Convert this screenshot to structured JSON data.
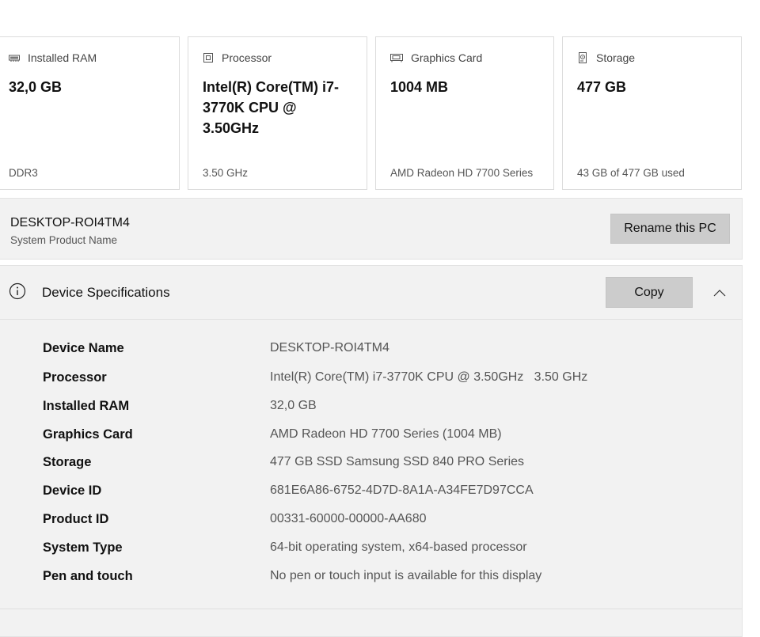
{
  "cards": [
    {
      "icon": "ram-icon",
      "label": "Installed RAM",
      "value": "32,0 GB",
      "sub": "DDR3"
    },
    {
      "icon": "processor-icon",
      "label": "Processor",
      "value": "Intel(R) Core(TM) i7-3770K CPU @ 3.50GHz",
      "sub": "3.50 GHz"
    },
    {
      "icon": "graphics-card-icon",
      "label": "Graphics Card",
      "value": "1004 MB",
      "sub": "AMD Radeon HD 7700 Series"
    },
    {
      "icon": "storage-icon",
      "label": "Storage",
      "value": "477 GB",
      "sub": "43 GB of 477 GB used"
    }
  ],
  "pc": {
    "name": "DESKTOP-ROI4TM4",
    "subtitle": "System Product Name",
    "rename_label": "Rename this PC"
  },
  "specs": {
    "title": "Device Specifications",
    "copy_label": "Copy",
    "rows": [
      {
        "key": "Device Name",
        "value": "DESKTOP-ROI4TM4"
      },
      {
        "key": "Processor",
        "value": "Intel(R) Core(TM) i7-3770K CPU @ 3.50GHz   3.50 GHz"
      },
      {
        "key": "Installed RAM",
        "value": "32,0 GB"
      },
      {
        "key": "Graphics Card",
        "value": "AMD Radeon HD 7700 Series (1004 MB)"
      },
      {
        "key": "Storage",
        "value": "477 GB SSD Samsung SSD 840 PRO Series"
      },
      {
        "key": "Device ID",
        "value": "681E6A86-6752-4D7D-8A1A-A34FE7D97CCA"
      },
      {
        "key": "Product ID",
        "value": "00331-60000-00000-AA680"
      },
      {
        "key": "System Type",
        "value": "64-bit operating system, x64-based processor"
      },
      {
        "key": "Pen and touch",
        "value": "No pen or touch input is available for this display"
      }
    ]
  }
}
